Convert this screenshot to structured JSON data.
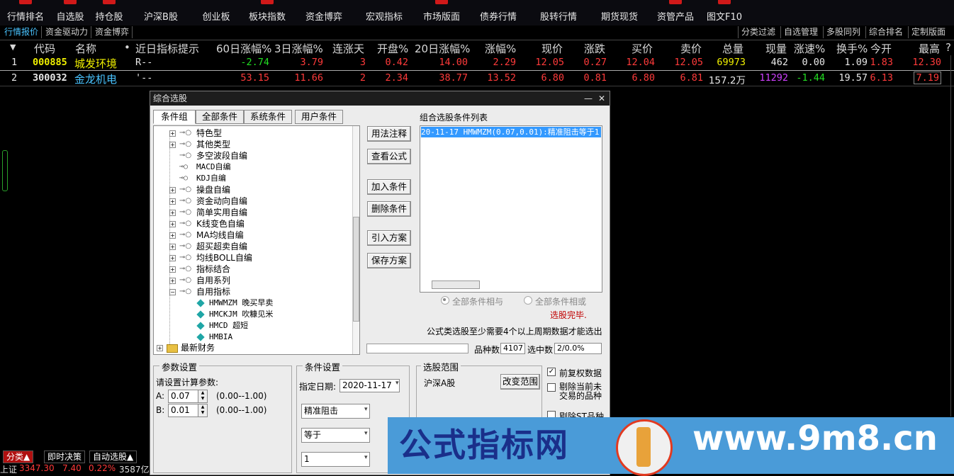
{
  "toolbar": {
    "items": [
      {
        "label": "行情排名"
      },
      {
        "label": "自选股"
      },
      {
        "label": "持仓股"
      },
      {
        "label": "沪深B股"
      },
      {
        "label": "创业板"
      },
      {
        "label": "板块指数"
      },
      {
        "label": "资金博弈"
      },
      {
        "label": "宏观指标"
      },
      {
        "label": "市场版面"
      },
      {
        "label": "债券行情"
      },
      {
        "label": "股转行情"
      },
      {
        "label": "期货现货"
      },
      {
        "label": "资管产品"
      },
      {
        "label": "图文F10"
      }
    ]
  },
  "tabs_left": [
    "行情报价",
    "资金驱动力",
    "资金博弈"
  ],
  "tabs_right": [
    "分类过滤",
    "自选管理",
    "多股同列",
    "综合排名",
    "定制版面"
  ],
  "grid": {
    "headers": [
      "代码",
      "名称",
      "•",
      "近日指标提示",
      "60日涨幅%",
      "3日涨幅%",
      "连涨天",
      "开盘%",
      "20日涨幅%",
      "涨幅%",
      "现价",
      "涨跌",
      "买价",
      "卖价",
      "总量",
      "现量",
      "涨速%",
      "换手%",
      "今开",
      "最高",
      "?"
    ],
    "rows": [
      {
        "idx": "1",
        "code": "000885",
        "name": "城发环境",
        "hint": "R--",
        "chg60": "-2.74",
        "chg3": "3.79",
        "updays": "3",
        "open_pct": "0.42",
        "chg20": "14.00",
        "chg": "2.29",
        "price": "12.05",
        "diff": "0.27",
        "bid": "12.04",
        "ask": "12.05",
        "vol": "69973",
        "curvol": "462",
        "speed": "0.00",
        "turnover": "1.09",
        "open": "1.83",
        "high": "12.30"
      },
      {
        "idx": "2",
        "code": "300032",
        "name": "金龙机电",
        "hint": "'--",
        "chg60": "53.15",
        "chg3": "11.66",
        "updays": "2",
        "open_pct": "2.34",
        "chg20": "38.77",
        "chg": "13.52",
        "price": "6.80",
        "diff": "0.81",
        "bid": "6.80",
        "ask": "6.81",
        "vol": "157.2万",
        "curvol": "11292",
        "speed": "-1.44",
        "turnover": "19.57",
        "open": "6.13",
        "high": "7.19"
      }
    ]
  },
  "status": {
    "tabs": [
      "分类▲",
      "即时决策",
      "自动选股▲"
    ],
    "index_name": "上证",
    "index_value": "3347.30",
    "index_change": "7.40",
    "index_pct": "0.22%",
    "index_amount": "3587亿"
  },
  "dialog": {
    "title": "综合选股",
    "minimize": "—",
    "close": "✕",
    "tabs": [
      "条件组",
      "全部条件",
      "系统条件",
      "用户条件"
    ],
    "tree": [
      {
        "label": "特色型",
        "kind": "folder"
      },
      {
        "label": "其他类型",
        "kind": "folder"
      },
      {
        "label": "多空波段自编",
        "kind": "leaf"
      },
      {
        "label": "MACD自编",
        "kind": "leaf"
      },
      {
        "label": "KDJ自编",
        "kind": "leaf"
      },
      {
        "label": "操盘自编",
        "kind": "folder"
      },
      {
        "label": "资金动向自编",
        "kind": "folder"
      },
      {
        "label": "简单实用自编",
        "kind": "folder"
      },
      {
        "label": "K线变色自编",
        "kind": "folder"
      },
      {
        "label": "MA均线自编",
        "kind": "folder"
      },
      {
        "label": "超买超卖自编",
        "kind": "folder"
      },
      {
        "label": "均线BOLL自编",
        "kind": "folder"
      },
      {
        "label": "指标结合",
        "kind": "folder"
      },
      {
        "label": "自用系列",
        "kind": "folder"
      },
      {
        "label": "自用指标",
        "kind": "open"
      },
      {
        "label": "HMWMZM 晚买早卖",
        "kind": "gem"
      },
      {
        "label": "HMCKJM 吹糠见米",
        "kind": "gem"
      },
      {
        "label": "HMCD 超短",
        "kind": "gem"
      },
      {
        "label": "HMBIA",
        "kind": "gem"
      },
      {
        "label": "最新财务",
        "kind": "root"
      }
    ],
    "buttons": [
      "用法注释",
      "查看公式",
      "加入条件",
      "删除条件",
      "引入方案",
      "保存方案"
    ],
    "cond_list_title": "组合选股条件列表",
    "cond_selected": "20-11-17 HMWMZM(0.07,0.01):精准阻击等于1",
    "radio_and": "全部条件相与",
    "radio_or": "全部条件相或",
    "done_text": "选股完毕.",
    "note": "公式类选股至少需要4个以上周期数据才能选出",
    "count_label": "品种数",
    "count_value": "4107",
    "selected_label": "选中数",
    "selected_value": "2/0.0%",
    "params": {
      "title": "参数设置",
      "prompt": "请设置计算参数:",
      "a_label": "A:",
      "a_value": "0.07",
      "a_range": "(0.00--1.00)",
      "b_label": "B:",
      "b_value": "0.01",
      "b_range": "(0.00--1.00)"
    },
    "condition": {
      "title": "条件设置",
      "date_label": "指定日期:",
      "date_value": "2020-11-17",
      "line": "精准阻击",
      "op": "等于",
      "value": "1"
    },
    "scope": {
      "title": "选股范围",
      "market": "沪深A股",
      "change_btn": "改变范围"
    },
    "options": {
      "rights": "前复权数据",
      "exclude_suspended": "剔除当前未交易的品种",
      "exclude_st": "剔除ST品种"
    }
  },
  "watermark": {
    "left_text": "公式指标网",
    "right_text": "www.9m8.cn"
  }
}
